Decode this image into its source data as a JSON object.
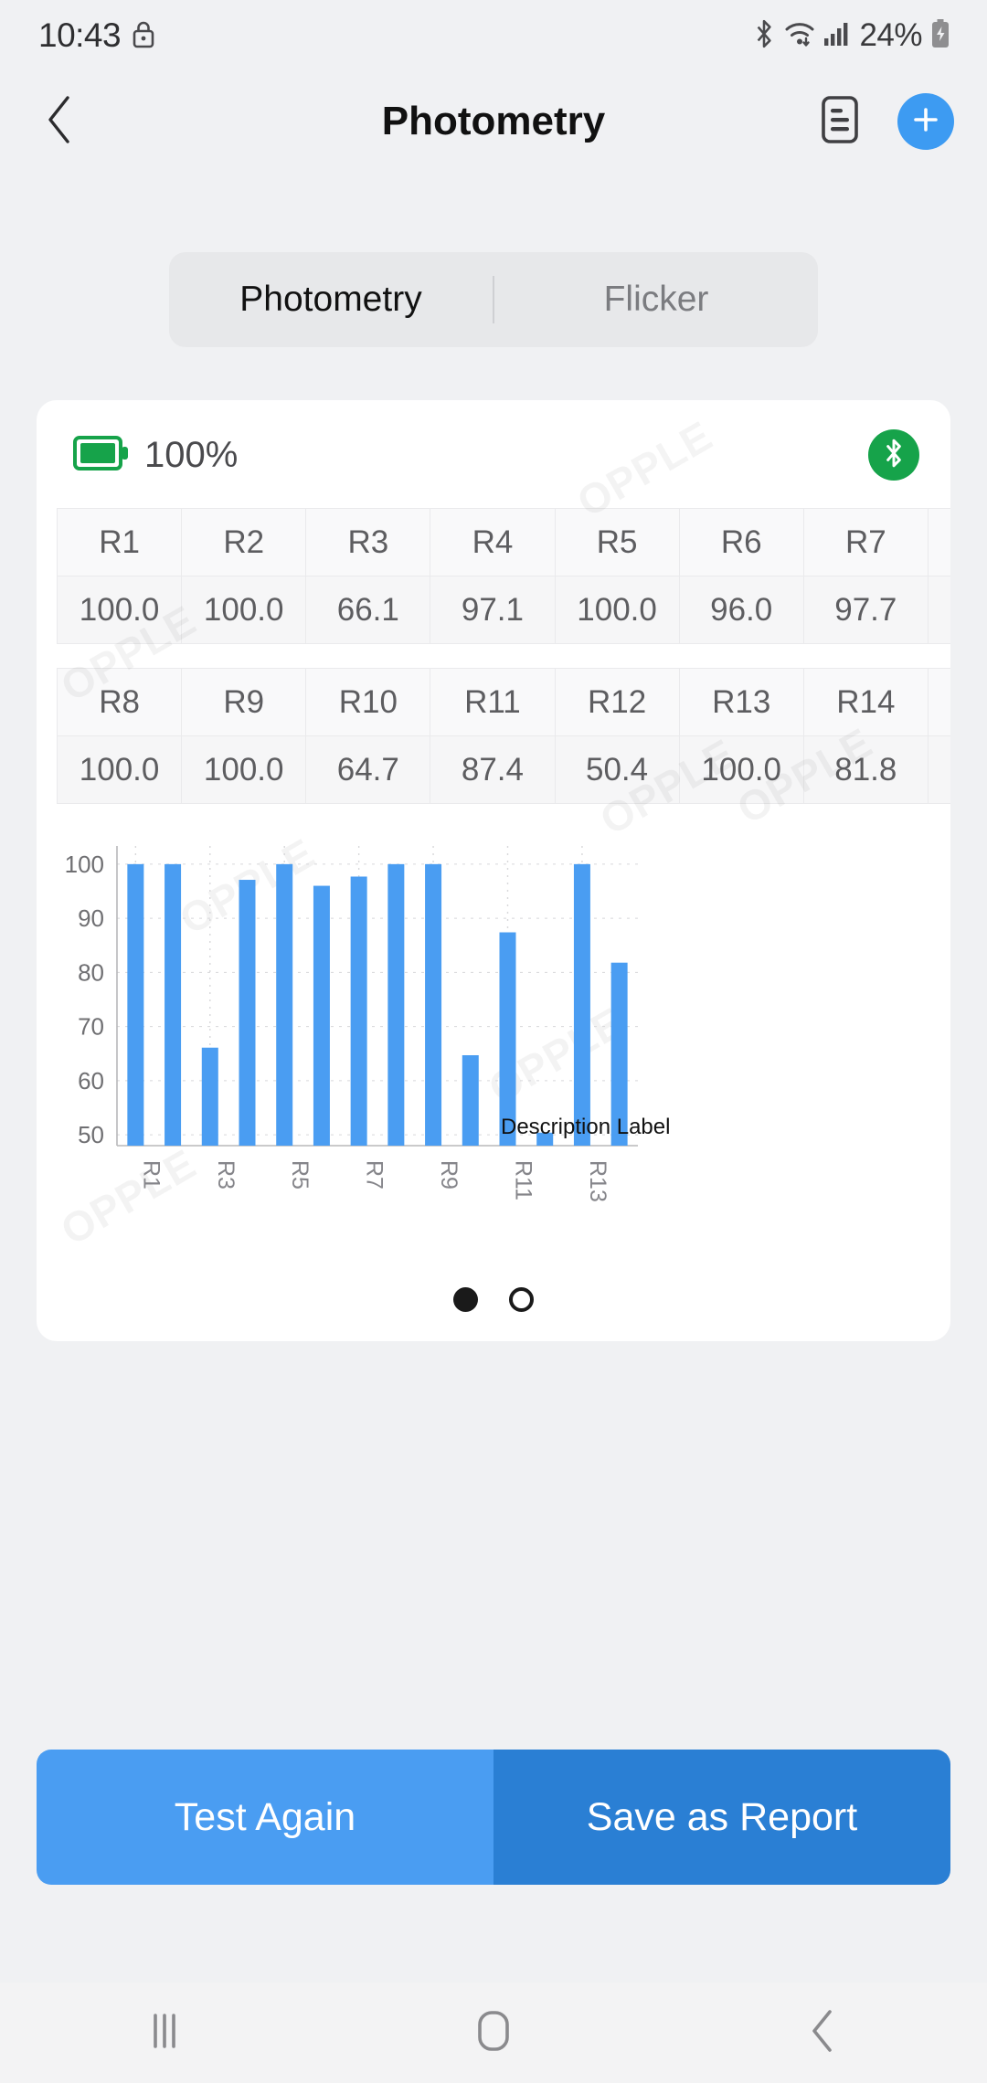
{
  "status_bar": {
    "time": "10:43",
    "battery_percent": "24%",
    "icons": [
      "lock-icon",
      "bluetooth-icon",
      "wifi-icon",
      "signal-icon",
      "battery-charging-icon"
    ]
  },
  "header": {
    "title": "Photometry",
    "back_icon": "chevron-left-icon",
    "report_icon": "document-list-icon",
    "add_icon": "plus-icon",
    "accent_color": "#3d9bf2"
  },
  "tabs": [
    {
      "label": "Photometry",
      "active": true
    },
    {
      "label": "Flicker",
      "active": false
    }
  ],
  "card": {
    "battery_label": "100%",
    "battery_color": "#16a34a",
    "bluetooth_badge_color": "#16a34a",
    "bluetooth_icon": "bluetooth-icon",
    "watermark_text": "OPPLE",
    "tables": [
      {
        "headers": [
          "R1",
          "R2",
          "R3",
          "R4",
          "R5",
          "R6",
          "R7",
          ""
        ],
        "values": [
          "100.0",
          "100.0",
          "66.1",
          "97.1",
          "100.0",
          "96.0",
          "97.7",
          ""
        ]
      },
      {
        "headers": [
          "R8",
          "R9",
          "R10",
          "R11",
          "R12",
          "R13",
          "R14",
          ""
        ],
        "values": [
          "100.0",
          "100.0",
          "64.7",
          "87.4",
          "50.4",
          "100.0",
          "81.8",
          ""
        ]
      }
    ],
    "pagination": {
      "total": 2,
      "active_index": 0
    }
  },
  "chart_data": {
    "type": "bar",
    "title": "",
    "xlabel": "",
    "ylabel": "",
    "categories": [
      "R1",
      "R2",
      "R3",
      "R4",
      "R5",
      "R6",
      "R7",
      "R8",
      "R9",
      "R10",
      "R11",
      "R12",
      "R13",
      "R14"
    ],
    "values": [
      100.0,
      100.0,
      66.1,
      97.1,
      100.0,
      96.0,
      97.7,
      100.0,
      100.0,
      64.7,
      87.4,
      50.4,
      100.0,
      81.8
    ],
    "visible_tick_labels": [
      "R1",
      "R3",
      "R5",
      "R7",
      "R9",
      "R11",
      "R13"
    ],
    "ytick_labels": [
      "100",
      "90",
      "80",
      "70",
      "60",
      "50"
    ],
    "yticks": [
      100,
      90,
      80,
      70,
      60,
      50
    ],
    "ylim": [
      48,
      102
    ],
    "grid": true,
    "legend": "none",
    "bar_color": "#4a9df2",
    "annotation": "Description Label"
  },
  "footer": {
    "test_again_label": "Test Again",
    "save_report_label": "Save as Report",
    "test_again_color": "#4a9df2",
    "save_report_color": "#2a7fd4"
  },
  "navbar": {
    "recents_icon": "recents-icon",
    "home_icon": "home-icon",
    "back_icon": "back-chevron-icon"
  }
}
